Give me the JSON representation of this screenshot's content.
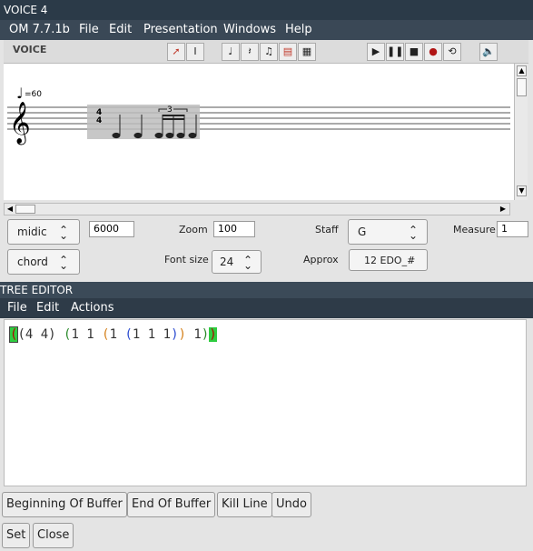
{
  "voice_window": {
    "title": "VOICE 4",
    "menu": {
      "app": "OM 7.7.1b",
      "file": "File",
      "edit": "Edit",
      "presentation": "Presentation",
      "windows": "Windows",
      "help": "Help"
    },
    "toolbar_label": "VOICE",
    "tempo": "=60",
    "tuplet": "3",
    "controls": {
      "midic_select": "midic",
      "midic_value": "6000",
      "zoom_label": "Zoom",
      "zoom_value": "100",
      "staff_label": "Staff",
      "staff_value": "G",
      "measure_label": "Measure",
      "measure_value": "1",
      "chord_select": "chord",
      "fontsize_label": "Font size",
      "fontsize_value": "24",
      "approx_label": "Approx",
      "approx_value": "12 EDO_#"
    }
  },
  "tree_window": {
    "title": "TREE EDITOR",
    "menu": {
      "file": "File",
      "edit": "Edit",
      "actions": "Actions"
    },
    "code": {
      "p1": "(",
      "p2": "(4 4) ",
      "p3": "(",
      "p4": "1 1 ",
      "p5": "(",
      "p6": "1 ",
      "p7": "(",
      "p8": "1 1 1",
      "p9": ")",
      "p10": ")",
      "p11": " 1",
      "p12": ")",
      "p13": ")"
    },
    "buttons": {
      "beginning": "Beginning Of Buffer",
      "end": "End Of Buffer",
      "kill": "Kill Line",
      "undo": "Undo",
      "set": "Set",
      "close": "Close"
    }
  }
}
